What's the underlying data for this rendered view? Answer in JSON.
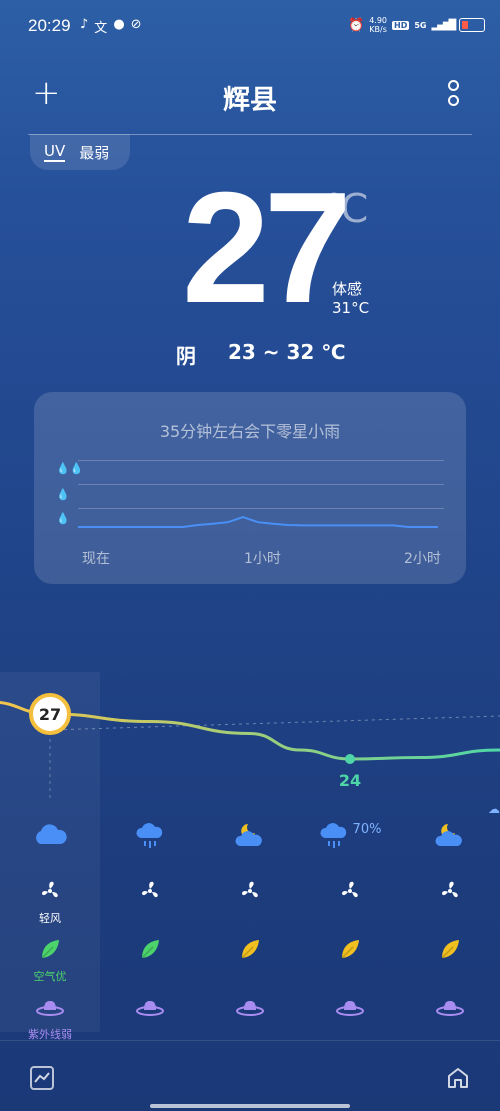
{
  "status": {
    "time": "20:29",
    "net_speed": "4.90",
    "net_unit": "KB/s",
    "hd": "HD",
    "signal": "5G"
  },
  "header": {
    "city": "辉县"
  },
  "uv": {
    "label": "UV",
    "value": "最弱"
  },
  "current": {
    "temp": "27",
    "unit": "℃",
    "feels_label": "体感",
    "feels_value": "31°C",
    "condition": "阴",
    "range": "23 ~ 32 ℃"
  },
  "rain_card": {
    "title": "35分钟左右会下零星小雨",
    "x_labels": [
      "现在",
      "1小时",
      "2小时"
    ],
    "precip_curve": [
      0,
      0,
      0,
      0,
      0,
      0,
      0,
      0,
      0.05,
      0.08,
      0.12,
      0.25,
      0.12,
      0.08,
      0.05,
      0.04,
      0.04,
      0.04,
      0.04,
      0.04,
      0.04,
      0.04,
      0,
      0,
      0
    ]
  },
  "hourly": {
    "temps": [
      27,
      26.6,
      26,
      25.2,
      24.3,
      24,
      24.1,
      24.6
    ],
    "temp_labels": {
      "current": "27",
      "min": "24"
    },
    "columns": [
      {
        "weather_icon": "cloud-icon",
        "precip": "",
        "wind_label": "轻风",
        "air_label": "空气优",
        "air_color": "#4cd36b",
        "uv_label": "紫外线弱"
      },
      {
        "weather_icon": "cloud-rain-icon",
        "precip": "",
        "wind_label": "",
        "air_label": "",
        "air_color": "#4cd36b",
        "uv_label": ""
      },
      {
        "weather_icon": "moon-cloud-icon",
        "precip": "",
        "wind_label": "",
        "air_label": "",
        "air_color": "#f0c020",
        "uv_label": ""
      },
      {
        "weather_icon": "cloud-rain-icon",
        "precip": "70%",
        "wind_label": "",
        "air_label": "",
        "air_color": "#f0c020",
        "uv_label": ""
      },
      {
        "weather_icon": "moon-cloud-icon",
        "precip": "",
        "wind_label": "",
        "air_label": "",
        "air_color": "#f0c020",
        "uv_label": ""
      }
    ]
  },
  "colors": {
    "accent": "#4a8ff5",
    "uv_purple": "#a98cf0",
    "temp_line_start": "#f6c54a",
    "temp_line_end": "#4fd6a8"
  }
}
